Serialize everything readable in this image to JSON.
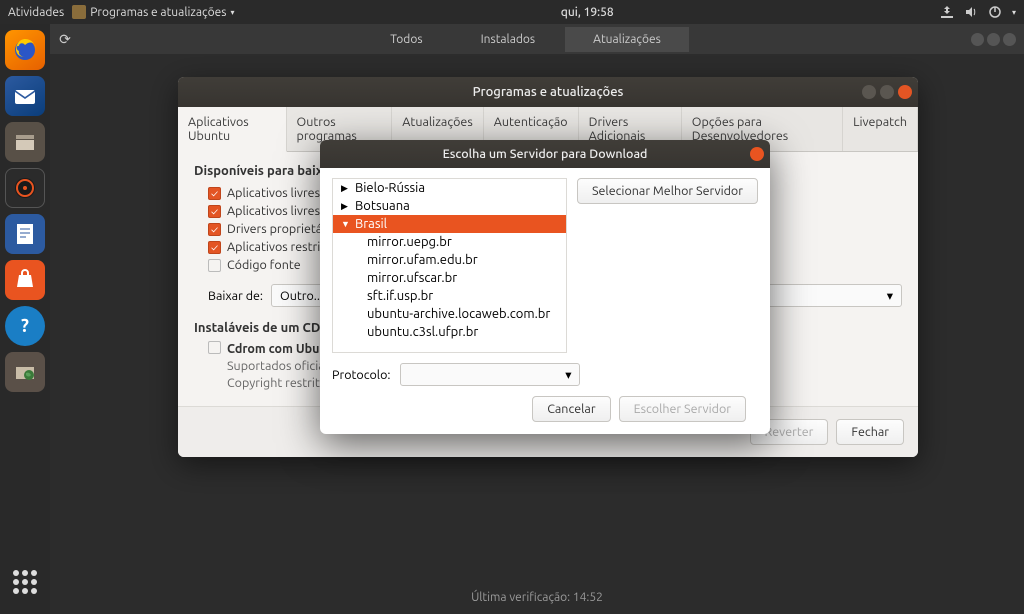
{
  "top_panel": {
    "activities": "Atividades",
    "app_menu": "Programas e atualizações",
    "clock": "qui, 19:58"
  },
  "updater_bar": {
    "tabs": {
      "all": "Todos",
      "installed": "Instalados",
      "updates": "Atualizações"
    }
  },
  "main_window": {
    "title": "Programas e atualizações",
    "tabs": {
      "ubuntu": "Aplicativos Ubuntu",
      "other": "Outros programas",
      "updates": "Atualizações",
      "auth": "Autenticação",
      "drivers": "Drivers Adicionais",
      "dev": "Opções para Desenvolvedores",
      "livepatch": "Livepatch"
    },
    "section_available": "Disponíveis para baixar",
    "checks": {
      "c1": "Aplicativos livres de",
      "c2": "Aplicativos livres de",
      "c3": "Drivers proprietário",
      "c4": "Aplicativos restrito",
      "c5": "Código fonte"
    },
    "download_from": {
      "label": "Baixar de:",
      "value": "Outro..."
    },
    "section_cdrom": "Instaláveis de um CD-R",
    "cdrom": {
      "line1": "Cdrom com Ubuntu",
      "line2": "Suportados oficialm",
      "line3": "Copyright restrito"
    },
    "footer": {
      "revert": "Reverter",
      "close": "Fechar"
    }
  },
  "modal": {
    "title": "Escolha um Servidor para Download",
    "select_best": "Selecionar Melhor Servidor",
    "countries": {
      "belarus": "Bielo-Rússia",
      "botswana": "Botsuana",
      "brazil": "Brasil"
    },
    "brazil_mirrors": [
      "mirror.uepg.br",
      "mirror.ufam.edu.br",
      "mirror.ufscar.br",
      "sft.if.usp.br",
      "ubuntu-archive.locaweb.com.br",
      "ubuntu.c3sl.ufpr.br"
    ],
    "protocol_label": "Protocolo:",
    "cancel": "Cancelar",
    "choose": "Escolher Servidor"
  },
  "status": "Última verificação: 14:52"
}
